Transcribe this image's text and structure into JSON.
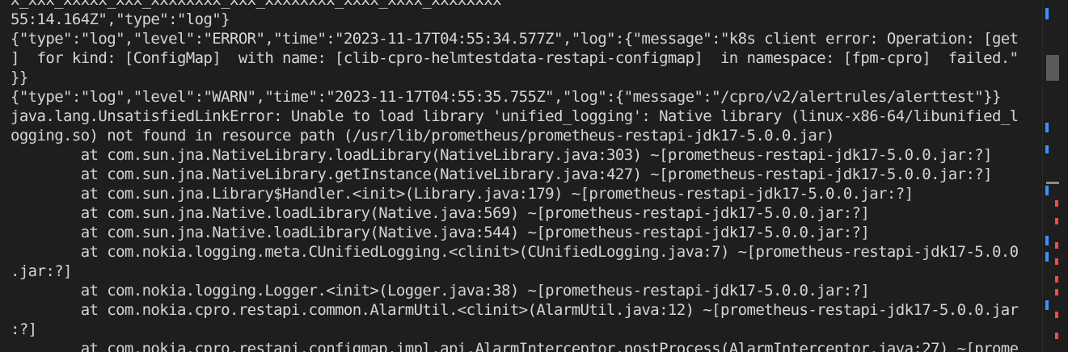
{
  "terminal": {
    "lines": [
      "x_xxx_xxxxx_xxx_xxxxxxxx_xxx_xxxxxxxx_xxxx_xxxx_xxxxxxxx",
      "55:14.164Z\",\"type\":\"log\"}",
      "{\"type\":\"log\",\"level\":\"ERROR\",\"time\":\"2023-11-17T04:55:34.577Z\",\"log\":{\"message\":\"k8s client error: Operation: [get",
      "]  for kind: [ConfigMap]  with name: [clib-cpro-helmtestdata-restapi-configmap]  in namespace: [fpm-cpro]  failed.\"",
      "}}",
      "{\"type\":\"log\",\"level\":\"WARN\",\"time\":\"2023-11-17T04:55:35.755Z\",\"log\":{\"message\":\"/cpro/v2/alertrules/alerttest\"}}",
      "java.lang.UnsatisfiedLinkError: Unable to load library 'unified_logging': Native library (linux-x86-64/libunified_l",
      "ogging.so) not found in resource path (/usr/lib/prometheus/prometheus-restapi-jdk17-5.0.0.jar)",
      "        at com.sun.jna.NativeLibrary.loadLibrary(NativeLibrary.java:303) ~[prometheus-restapi-jdk17-5.0.0.jar:?]",
      "        at com.sun.jna.NativeLibrary.getInstance(NativeLibrary.java:427) ~[prometheus-restapi-jdk17-5.0.0.jar:?]",
      "        at com.sun.jna.Library$Handler.<init>(Library.java:179) ~[prometheus-restapi-jdk17-5.0.0.jar:?]",
      "        at com.sun.jna.Native.loadLibrary(Native.java:569) ~[prometheus-restapi-jdk17-5.0.0.jar:?]",
      "        at com.sun.jna.Native.loadLibrary(Native.java:544) ~[prometheus-restapi-jdk17-5.0.0.jar:?]",
      "        at com.nokia.logging.meta.CUnifiedLogging.<clinit>(CUnifiedLogging.java:7) ~[prometheus-restapi-jdk17-5.0.0",
      ".jar:?]",
      "        at com.nokia.logging.Logger.<init>(Logger.java:38) ~[prometheus-restapi-jdk17-5.0.0.jar:?]",
      "        at com.nokia.cpro.restapi.common.AlarmUtil.<clinit>(AlarmUtil.java:12) ~[prometheus-restapi-jdk17-5.0.0.jar",
      ":?]",
      "        at com.nokia.cpro.restapi.configmap.impl.api.AlarmInterceptor.postProcess(AlarmInterceptor.java:27) ~[prome"
    ]
  },
  "colors": {
    "background": "#1e1e1e",
    "text": "#d4d4d4",
    "scrollbar_thumb": "#5a5a5a",
    "marker_blue": "#3794ff",
    "marker_red": "#f14c4c",
    "marker_gray": "#8c8c8c"
  }
}
